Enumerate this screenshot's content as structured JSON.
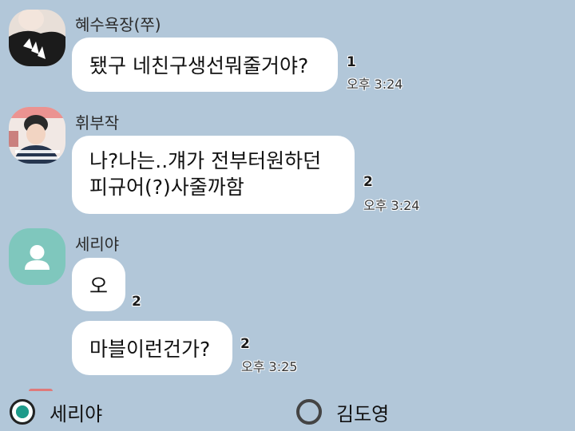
{
  "chat": {
    "messages": [
      {
        "sender": "혜수욕장(쭈)",
        "bubbles": [
          {
            "lines": [
              "됐구 네친구생선뭐줄거야?"
            ],
            "unread": "1",
            "time": "오후 3:24"
          }
        ]
      },
      {
        "sender": "휘부작",
        "bubbles": [
          {
            "lines": [
              "나?나는..걔가 전부터원하던",
              "피규어(?)사줄까함"
            ],
            "unread": "2",
            "time": "오후 3:24"
          }
        ]
      },
      {
        "sender": "세리야",
        "bubbles": [
          {
            "lines": [
              "오"
            ],
            "unread": "2",
            "time": ""
          },
          {
            "lines": [
              "마블이런건가?"
            ],
            "unread": "2",
            "time": "오후 3:25"
          }
        ]
      }
    ]
  },
  "poll": {
    "options": [
      {
        "label": "세리야",
        "checked": true
      },
      {
        "label": "김도영",
        "checked": false
      }
    ]
  },
  "colors": {
    "background": "#b2c7d9",
    "bubble": "#ffffff",
    "default_avatar": "#7fc7bd",
    "radio_accent": "#1e9b8a"
  }
}
